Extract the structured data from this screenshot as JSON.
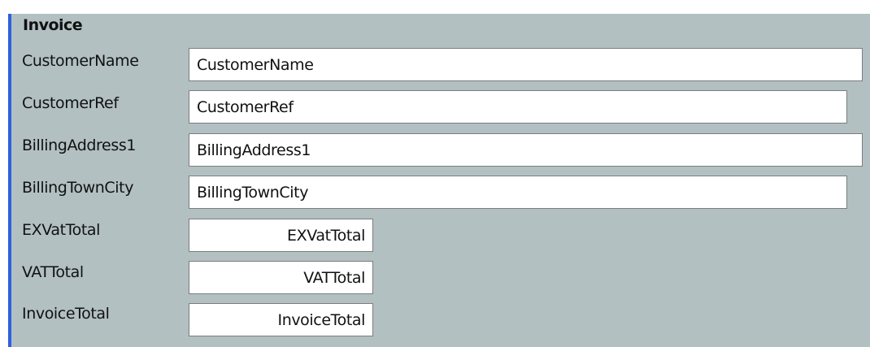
{
  "form": {
    "title": "Invoice",
    "fields": [
      {
        "label": "CustomerName",
        "value": "CustomerName"
      },
      {
        "label": "CustomerRef",
        "value": "CustomerRef"
      },
      {
        "label": "BillingAddress1",
        "value": "BillingAddress1"
      },
      {
        "label": "BillingTownCity",
        "value": "BillingTownCity"
      },
      {
        "label": "EXVatTotal",
        "value": "EXVatTotal"
      },
      {
        "label": "VATTotal",
        "value": "VATTotal"
      },
      {
        "label": "InvoiceTotal",
        "value": "InvoiceTotal"
      }
    ]
  },
  "colors": {
    "panel_background": "#b2c0c2",
    "accent_border": "#2f5fe0",
    "input_background": "#ffffff",
    "input_border": "#7d7d7d"
  }
}
